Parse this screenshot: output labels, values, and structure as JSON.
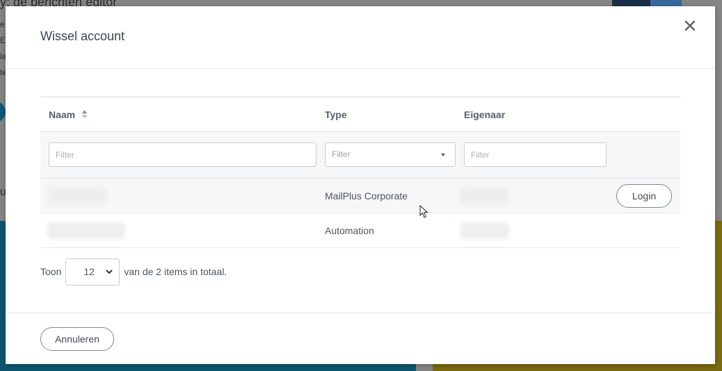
{
  "background": {
    "heading": "y; de berichten editor",
    "fragments": [
      "e",
      "E",
      "la",
      "te"
    ],
    "letter": "u"
  },
  "modal": {
    "title": "Wissel account",
    "close_icon": "close-icon",
    "table": {
      "columns": {
        "name": "Naam",
        "type": "Type",
        "owner": "Eigenaar"
      },
      "sort_icon": "sort-icon",
      "filters": {
        "name_placeholder": "Filter",
        "type_value": "Filter",
        "owner_placeholder": "Filter"
      },
      "rows": [
        {
          "type": "MailPlus Corporate",
          "action": "Login"
        },
        {
          "type": "Automation"
        }
      ]
    },
    "pager": {
      "prefix": "Toon",
      "page_size": "12",
      "suffix": "van de 2 items in totaal."
    },
    "footer": {
      "cancel_label": "Annuleren"
    }
  }
}
